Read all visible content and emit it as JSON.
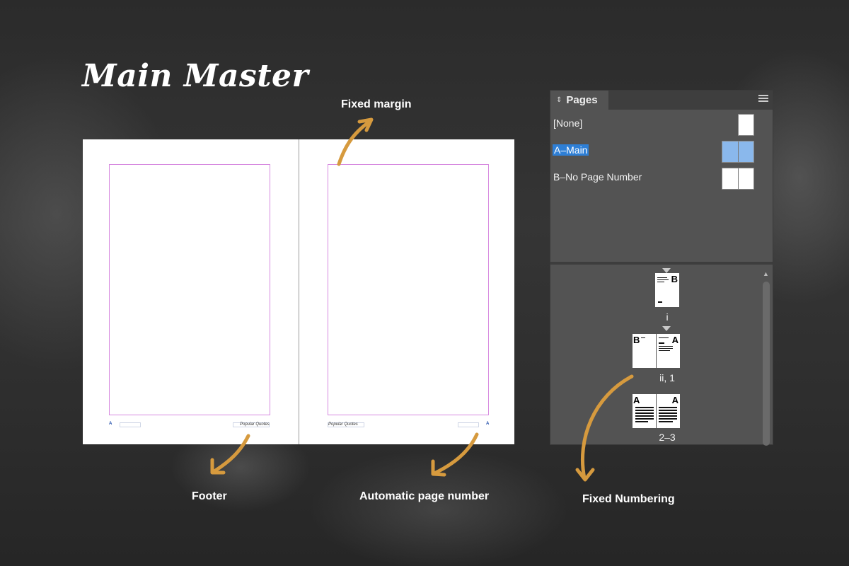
{
  "title": "Main Master",
  "callouts": {
    "fixed_margin": "Fixed margin",
    "footer": "Footer",
    "auto_page_number": "Automatic page number",
    "fixed_numbering": "Fixed Numbering"
  },
  "spread": {
    "left_footer_letter": "A",
    "left_footer_text": "Popular Quotes",
    "right_footer_text": "Popular Quotes",
    "right_footer_letter": "A"
  },
  "panel": {
    "tab_label": "Pages",
    "tab_icon": "collapse-arrows-icon",
    "menu_icon": "panel-menu-icon",
    "masters": [
      {
        "label": "[None]"
      },
      {
        "label": "A–Main"
      },
      {
        "label": "B–No Page Number"
      }
    ],
    "pages": [
      {
        "label": "i",
        "letters": [
          "B"
        ]
      },
      {
        "label": "ii, 1",
        "letters": [
          "B",
          "A"
        ]
      },
      {
        "label": "2–3",
        "letters": [
          "A",
          "A"
        ]
      }
    ]
  },
  "colors": {
    "accent_arrow": "#d69a3e",
    "margin_guide": "#d78ae0",
    "selection": "#2e7fd6",
    "panel_bg": "#535353"
  }
}
